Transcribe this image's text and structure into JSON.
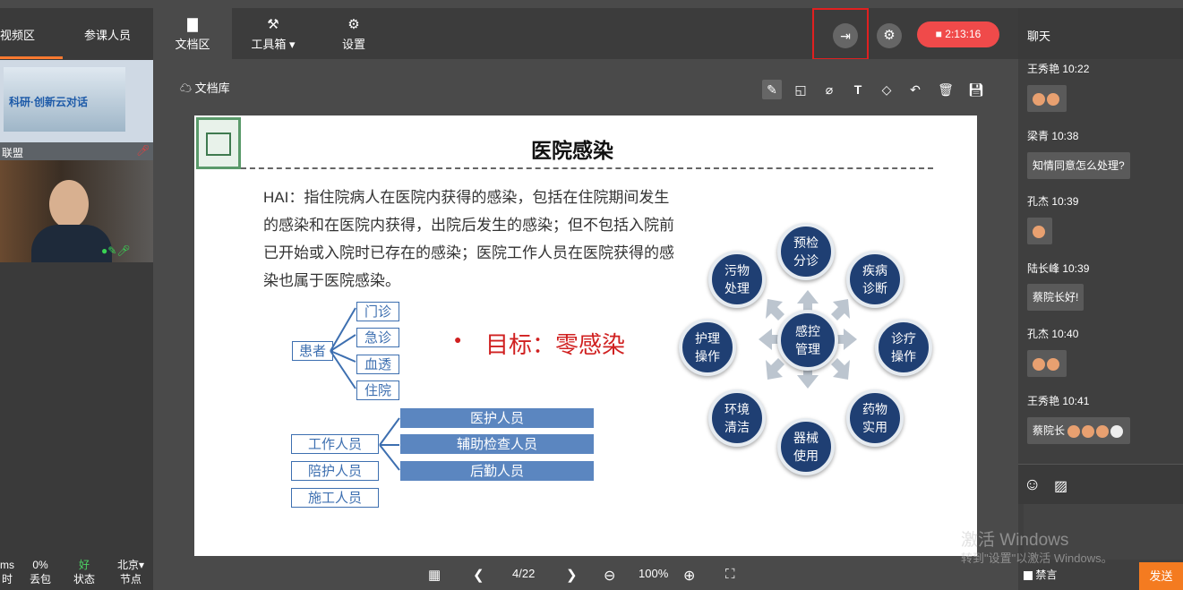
{
  "left_panel": {
    "tabs": [
      "视频区",
      "参课人员"
    ],
    "video1_banner": "科研·创新云对话",
    "video1_label": "联盟",
    "stats": [
      {
        "value": "ms",
        "label": "时"
      },
      {
        "value": "0%",
        "label": "丢包"
      },
      {
        "value": "好",
        "label": "状态"
      },
      {
        "value": "北京▾",
        "label": "节点"
      }
    ]
  },
  "toolbar": {
    "items": [
      {
        "label": "文档区",
        "icon": "folder-icon"
      },
      {
        "label": "工具箱 ▾",
        "icon": "toolbox-icon"
      },
      {
        "label": "设置",
        "icon": "gear-icon"
      }
    ],
    "timer": "2:13:16"
  },
  "doc": {
    "library_label": "文档库",
    "page_indicator": "4/22",
    "zoom": "100%"
  },
  "slide": {
    "title": "医院感染",
    "body": "HAI：指住院病人在医院内获得的感染，包括在住院期间发生的感染和在医院内获得，出院后发生的感染；但不包括入院前已开始或入院时已存在的感染；医院工作人员在医院获得的感染也属于医院感染。",
    "patient_label": "患者",
    "patient_items": [
      "门诊",
      "急诊",
      "血透",
      "住院"
    ],
    "goal": "目标：零感染",
    "staff_labels": [
      "工作人员",
      "陪护人员",
      "施工人员"
    ],
    "staff_items": [
      "医护人员",
      "辅助检查人员",
      "后勤人员"
    ],
    "cycle_center": "感控\n管理",
    "cycle_nodes": [
      "预检\n分诊",
      "疾病\n诊断",
      "诊疗\n操作",
      "药物\n实用",
      "器械\n使用",
      "环境\n清洁",
      "护理\n操作",
      "污物\n处理"
    ]
  },
  "chat": {
    "title": "聊天",
    "messages": [
      {
        "name": "王秀艳 10:22",
        "text": ""
      },
      {
        "name": "梁青 10:38",
        "text": "知情同意怎么处理?"
      },
      {
        "name": "孔杰 10:39",
        "text": ""
      },
      {
        "name": "陆长峰 10:39",
        "text": "蔡院长好!"
      },
      {
        "name": "孔杰 10:40",
        "text": ""
      },
      {
        "name": "王秀艳 10:41",
        "text": "蔡院长"
      }
    ],
    "mute_label": "禁言",
    "send_label": "发送"
  },
  "watermark": {
    "line1": "激活 Windows",
    "line2": "转到\"设置\"以激活 Windows。"
  }
}
